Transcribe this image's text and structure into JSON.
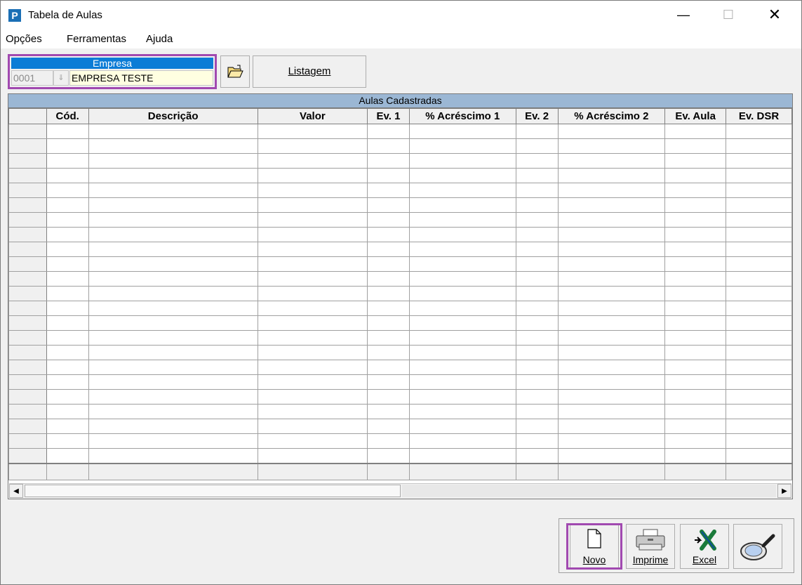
{
  "window": {
    "title": "Tabela de Aulas",
    "icon_letter": "P",
    "minimize": "—",
    "maximize": "☐",
    "close": "✕"
  },
  "menu": {
    "items": [
      "Opções",
      "Ferramentas",
      "Ajuda"
    ]
  },
  "empresa": {
    "label": "Empresa",
    "code": "0001",
    "name": "EMPRESA TESTE"
  },
  "toolbar": {
    "listagem_label": "Listagem"
  },
  "grid": {
    "caption": "Aulas Cadastradas",
    "columns": [
      "",
      "Cód.",
      "Descrição",
      "Valor",
      "Ev. 1",
      "% Acréscimo 1",
      "Ev. 2",
      "% Acréscimo 2",
      "Ev. Aula",
      "Ev. DSR"
    ]
  },
  "buttons": {
    "novo": "Novo",
    "imprime": "Imprime",
    "excel": "Excel"
  },
  "icons": {
    "open_folder": "open-folder-icon",
    "new_doc": "new-document-icon",
    "printer": "printer-icon",
    "excel": "excel-icon",
    "search": "magnifier-icon"
  },
  "colors": {
    "accent": "#0b7cd6",
    "highlight": "#a149b0",
    "caption": "#9bb7d4",
    "field_bg": "#ffffe1"
  }
}
